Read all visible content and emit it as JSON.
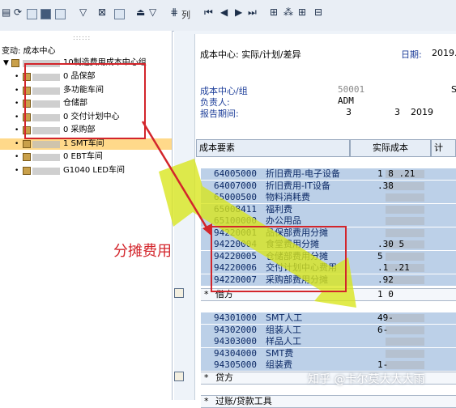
{
  "toolbar": {
    "icons": [
      "save-icon",
      "refresh-icon",
      "print-icon",
      "find-icon",
      "filter-icon",
      "sort-icon",
      "layout-icon",
      "sum-icon",
      "export-icon",
      "columns-icon",
      "first-icon",
      "prev-icon",
      "next-icon",
      "last-icon",
      "hierarchy-icon",
      "tree-icon",
      "expand-icon",
      "collapse-icon"
    ],
    "column_label": "列"
  },
  "tree": {
    "header": "变动: 成本中心",
    "root_label": "10制造费用成本中心组",
    "items": [
      {
        "label": "0 品保部",
        "selected": false
      },
      {
        "label": "多功能车间",
        "selected": false
      },
      {
        "label": "仓储部",
        "selected": false
      },
      {
        "label": "0 交付计划中心",
        "selected": false
      },
      {
        "label": "0 采购部",
        "selected": false
      },
      {
        "label": "1 SMT车间",
        "selected": true
      },
      {
        "label": "0 EBT车间",
        "selected": false
      },
      {
        "label": "G1040 LED车间",
        "selected": false
      }
    ]
  },
  "report": {
    "title": "成本中心: 实际/计划/差异",
    "date_label": "日期:",
    "date_value": "2019.",
    "cc_label": "成本中心/组",
    "cc_value": "50001",
    "cc_extra": "S",
    "owner_label": "负责人:",
    "owner_value": "ADM",
    "period_label": "报告期间:",
    "period_from": "3",
    "period_to": "3",
    "period_year": "2019"
  },
  "columns": {
    "element": "成本要素",
    "actual": "实际成本",
    "plan": "计"
  },
  "group1": [
    {
      "code": "64005000",
      "name": "折旧费用-电子设备",
      "amount": "1   8  .21"
    },
    {
      "code": "64007000",
      "name": "折旧费用-IT设备",
      "amount": "  .38"
    },
    {
      "code": "65000500",
      "name": "物料消耗费",
      "amount": ""
    },
    {
      "code": "65008411",
      "name": "福利费",
      "amount": ""
    },
    {
      "code": "65100000",
      "name": "办公用品",
      "amount": ""
    },
    {
      "code": "94220001",
      "name": "品保部费用分摊",
      "amount": ""
    },
    {
      "code": "94220004",
      "name": "食堂费用分摊",
      "amount": " .30  5"
    },
    {
      "code": "94220005",
      "name": "仓储部费用分摊",
      "amount": "   5"
    },
    {
      "code": "94220006",
      "name": "交付计划中心费用",
      "amount": "  .1  .21"
    },
    {
      "code": "94220007",
      "name": "采购部费用分摊",
      "amount": "   .92"
    }
  ],
  "total1": {
    "label": "借方",
    "amount": "1 0  "
  },
  "group2": [
    {
      "code": "94301000",
      "name": "SMT人工",
      "amount": "  49-"
    },
    {
      "code": "94302000",
      "name": "组装人工",
      "amount": "  6-"
    },
    {
      "code": "94303000",
      "name": "样品人工",
      "amount": ""
    },
    {
      "code": "94304000",
      "name": "SMT费",
      "amount": ""
    },
    {
      "code": "94305000",
      "name": "组装费",
      "amount": "  1-"
    }
  ],
  "total2": {
    "label": "贷方",
    "amount": ""
  },
  "total3": {
    "label": "过账/贷款工具",
    "amount": ""
  },
  "annotation": "分摊费用",
  "watermark": "知乎 @卡尔莫大大大雨",
  "colors": {
    "annotation": "#d3252b",
    "selected_row": "#ffd98a",
    "blue_row": "#bcd0e8",
    "arrow": "#d9e61a"
  }
}
